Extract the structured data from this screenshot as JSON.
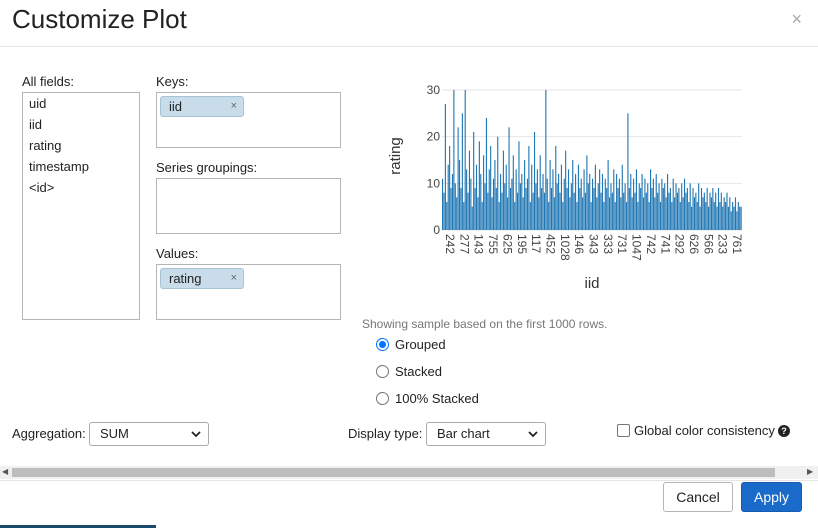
{
  "dialog": {
    "title": "Customize Plot",
    "close_icon": "×"
  },
  "fields": {
    "all_fields_label": "All fields:",
    "all_fields": [
      "uid",
      "iid",
      "rating",
      "timestamp",
      "<id>"
    ],
    "keys_label": "Keys:",
    "keys": [
      "iid"
    ],
    "series_label": "Series groupings:",
    "series": [],
    "values_label": "Values:",
    "values": [
      "rating"
    ],
    "token_remove": "×"
  },
  "chart_data": {
    "type": "bar",
    "xlabel": "iid",
    "ylabel": "rating",
    "ylim": [
      0,
      30
    ],
    "yticks": [
      0,
      10,
      20,
      30
    ],
    "xtick_labels": [
      "242",
      "277",
      "143",
      "755",
      "625",
      "195",
      "117",
      "452",
      "1028",
      "146",
      "343",
      "333",
      "731",
      "1047",
      "742",
      "741",
      "292",
      "626",
      "566",
      "233",
      "761"
    ],
    "color": "#1f77b4",
    "values": [
      11,
      8,
      27,
      6,
      14,
      18,
      9,
      12,
      30,
      10,
      7,
      22,
      15,
      9,
      25,
      6,
      30,
      13,
      8,
      17,
      11,
      5,
      21,
      9,
      14,
      7,
      19,
      12,
      6,
      16,
      10,
      24,
      8,
      13,
      18,
      7,
      11,
      15,
      9,
      20,
      6,
      12,
      8,
      17,
      10,
      14,
      7,
      22,
      9,
      11,
      16,
      6,
      13,
      8,
      19,
      10,
      12,
      7,
      15,
      9,
      11,
      18,
      6,
      14,
      8,
      21,
      10,
      13,
      7,
      16,
      9,
      12,
      8,
      30,
      11,
      6,
      15,
      9,
      13,
      7,
      18,
      10,
      12,
      8,
      14,
      6,
      11,
      17,
      9,
      13,
      7,
      10,
      15,
      8,
      12,
      6,
      14,
      9,
      11,
      7,
      13,
      8,
      16,
      10,
      12,
      6,
      11,
      9,
      14,
      7,
      10,
      13,
      8,
      12,
      6,
      11,
      9,
      15,
      7,
      10,
      8,
      13,
      6,
      12,
      9,
      11,
      7,
      14,
      8,
      10,
      6,
      25,
      9,
      12,
      7,
      11,
      8,
      13,
      6,
      10,
      9,
      12,
      7,
      11,
      8,
      10,
      6,
      13,
      9,
      11,
      7,
      12,
      8,
      10,
      6,
      11,
      9,
      10,
      7,
      12,
      8,
      9,
      6,
      11,
      7,
      10,
      8,
      9,
      6,
      10,
      7,
      11,
      8,
      9,
      6,
      10,
      5,
      9,
      7,
      8,
      6,
      10,
      5,
      9,
      7,
      8,
      6,
      9,
      5,
      8,
      7,
      9,
      6,
      8,
      5,
      9,
      6,
      8,
      5,
      7,
      6,
      8,
      5,
      7,
      4,
      6,
      5,
      7,
      4,
      6,
      5,
      5
    ]
  },
  "note": "Showing sample based on the first 1000 rows.",
  "chart_mode": {
    "options": [
      "Grouped",
      "Stacked",
      "100% Stacked"
    ],
    "selected": "Grouped"
  },
  "aggregation": {
    "label": "Aggregation:",
    "value": "SUM"
  },
  "display_type": {
    "label": "Display type:",
    "value": "Bar chart"
  },
  "color_consistency": {
    "label": "Global color consistency",
    "checked": false,
    "help": "?"
  },
  "footer": {
    "cancel": "Cancel",
    "apply": "Apply"
  }
}
